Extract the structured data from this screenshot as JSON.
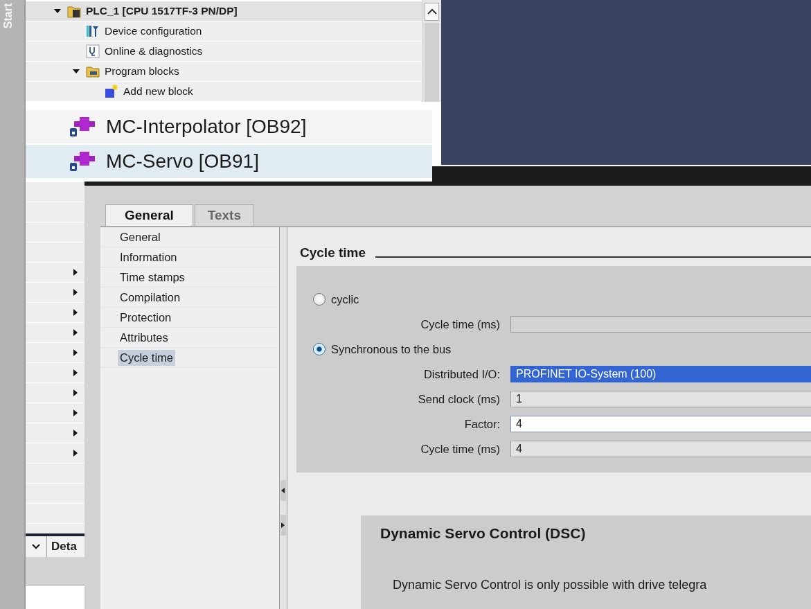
{
  "side_strip": {
    "label": "Start"
  },
  "project_tree": {
    "items": [
      {
        "label": "PLC_1 [CPU 1517TF-3 PN/DP]",
        "kind": "plc",
        "expanded": true,
        "children": [
          {
            "label": "Device configuration",
            "kind": "device"
          },
          {
            "label": "Online & diagnostics",
            "kind": "diagnostics"
          },
          {
            "label": "Program blocks",
            "kind": "folder",
            "expanded": true,
            "children": [
              {
                "label": "Add new block",
                "kind": "add"
              }
            ]
          }
        ]
      }
    ],
    "collapsed_rows": [
      {
        "expandable": false
      },
      {
        "expandable": false
      },
      {
        "expandable": false
      },
      {
        "expandable": false
      },
      {
        "expandable": true
      },
      {
        "expandable": true
      },
      {
        "expandable": true
      },
      {
        "expandable": true
      },
      {
        "expandable": true
      },
      {
        "expandable": true
      },
      {
        "expandable": true
      },
      {
        "expandable": true
      },
      {
        "expandable": true
      },
      {
        "expandable": true
      },
      {
        "expandable": false
      },
      {
        "expandable": false
      },
      {
        "expandable": false
      },
      {
        "expandable": false
      }
    ],
    "details_label": "Deta"
  },
  "magnified_blocks": [
    {
      "label": "MC-Interpolator [OB92]",
      "selected": false
    },
    {
      "label": "MC-Servo [OB91]",
      "selected": true
    }
  ],
  "properties": {
    "tabs": [
      {
        "label": "General",
        "selected": true
      },
      {
        "label": "Texts",
        "selected": false
      }
    ],
    "nav_items": [
      {
        "label": "General",
        "selected": false
      },
      {
        "label": "Information",
        "selected": false
      },
      {
        "label": "Time stamps",
        "selected": false
      },
      {
        "label": "Compilation",
        "selected": false
      },
      {
        "label": "Protection",
        "selected": false
      },
      {
        "label": "Attributes",
        "selected": false
      },
      {
        "label": "Cycle time",
        "selected": true
      }
    ],
    "section_title": "Cycle time",
    "rows": [
      {
        "kind": "radio",
        "label": "cyclic",
        "selected": false
      },
      {
        "kind": "field",
        "label": "Cycle time (ms)",
        "disabled": true,
        "read_only": false,
        "selected": false
      },
      {
        "kind": "radio",
        "label": "Synchronous to the bus",
        "selected": true
      },
      {
        "kind": "field",
        "label": "Distributed I/O:",
        "value": "PROFINET IO-System (100)",
        "disabled": false,
        "read_only": false,
        "selected": true
      },
      {
        "kind": "field",
        "label": "Send clock (ms)",
        "value": "1",
        "disabled": false,
        "read_only": true,
        "selected": false
      },
      {
        "kind": "field",
        "label": "Factor:",
        "value": "4",
        "disabled": false,
        "read_only": false,
        "selected": false
      },
      {
        "kind": "field",
        "label": "Cycle time (ms)",
        "value": "4",
        "disabled": false,
        "read_only": true,
        "selected": false
      }
    ],
    "dsc": {
      "title": "Dynamic Servo Control (DSC)",
      "text": "Dynamic Servo Control is only possible with drive telegra"
    }
  }
}
